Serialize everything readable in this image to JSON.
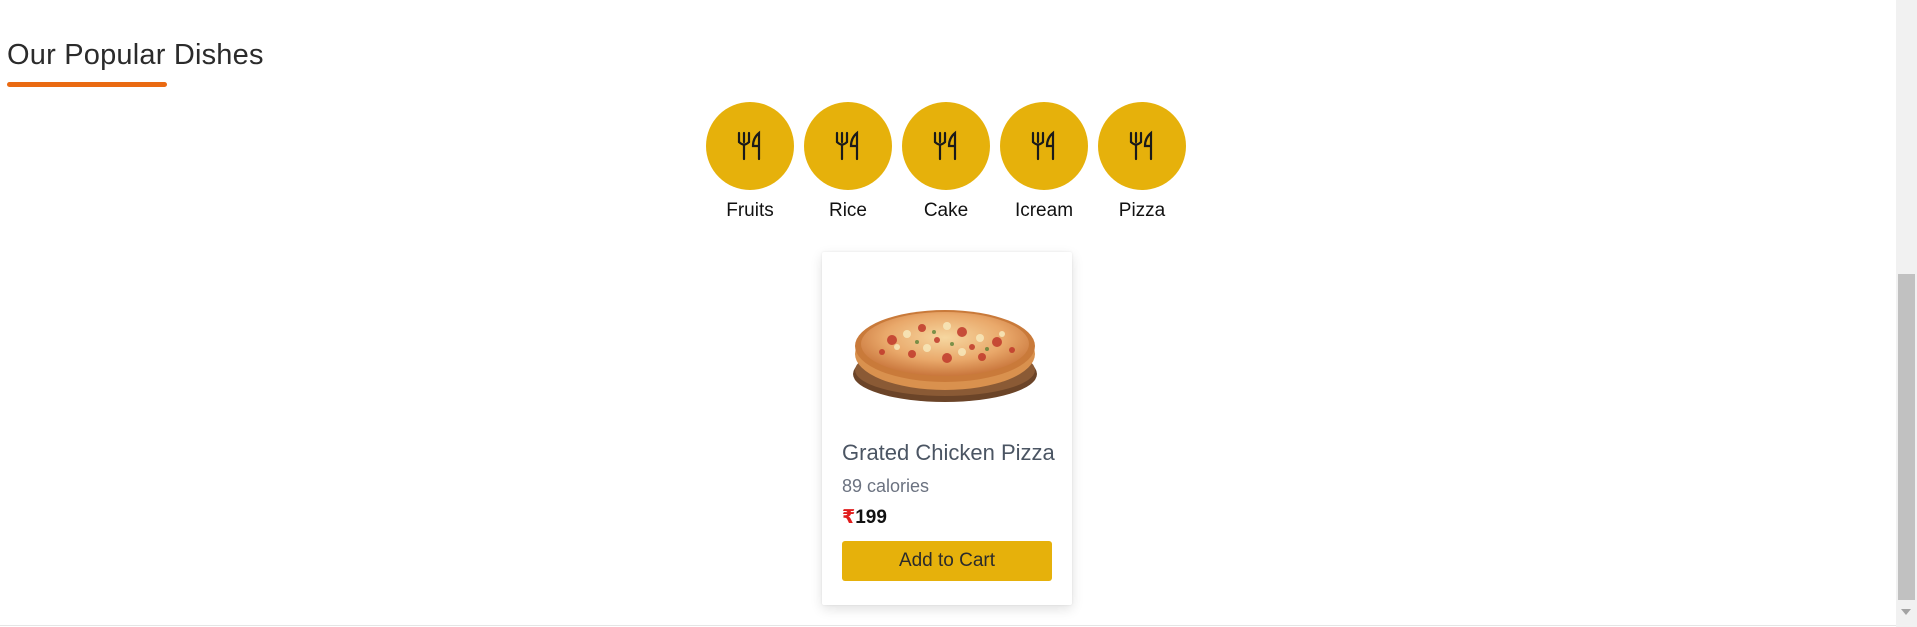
{
  "section": {
    "title": "Our Popular Dishes",
    "underline_color": "#ea6a12"
  },
  "categories": [
    {
      "label": "Fruits",
      "icon": "utensils-icon"
    },
    {
      "label": "Rice",
      "icon": "utensils-icon"
    },
    {
      "label": "Cake",
      "icon": "utensils-icon"
    },
    {
      "label": "Icream",
      "icon": "utensils-icon"
    },
    {
      "label": "Pizza",
      "icon": "utensils-icon"
    }
  ],
  "accent_color": "#e6b10b",
  "card": {
    "image": "pizza-image",
    "name": "Grated Chicken Pizza",
    "calories": "89 calories",
    "currency": "₹",
    "price": "199",
    "button_label": "Add to Cart"
  }
}
